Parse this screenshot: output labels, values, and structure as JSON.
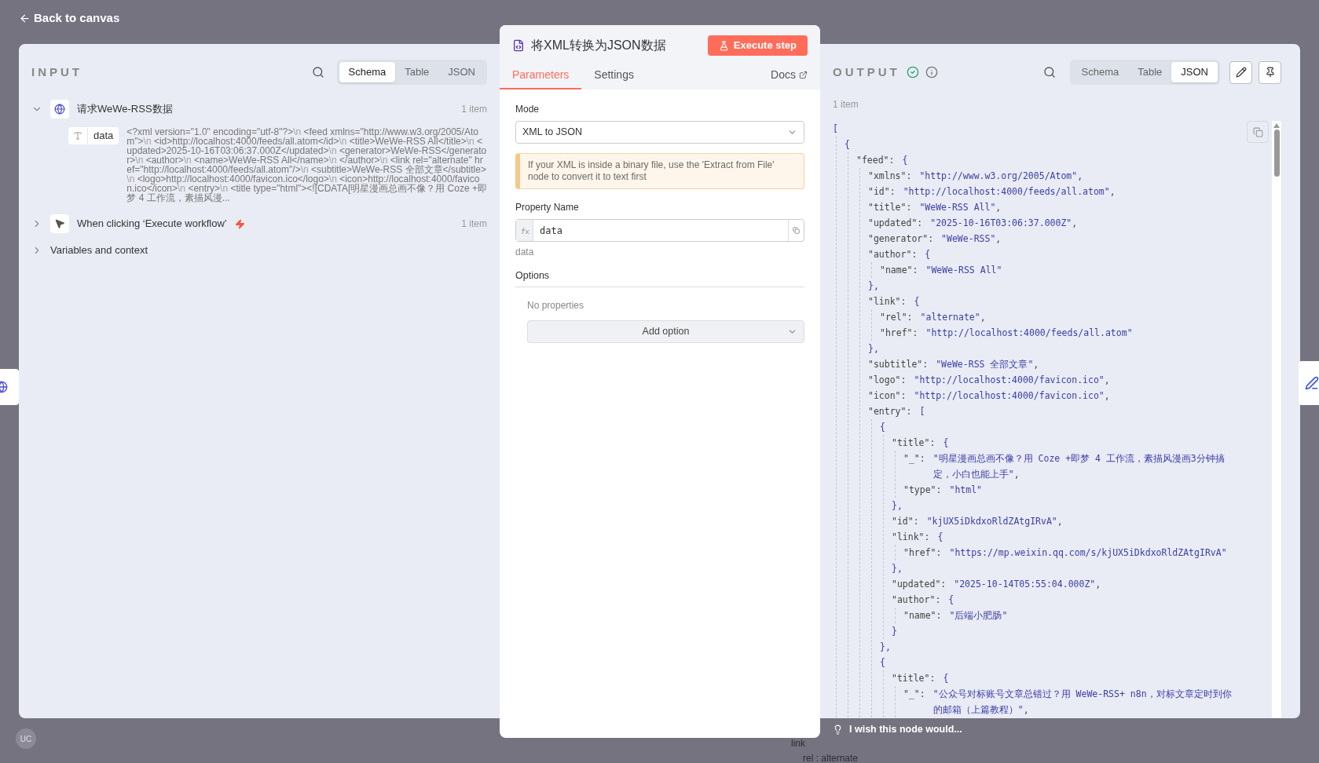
{
  "back_link": "Back to canvas",
  "input": {
    "title": "INPUT",
    "view_tabs": [
      {
        "label": "Schema",
        "selected": true
      },
      {
        "label": "Table",
        "selected": false
      },
      {
        "label": "JSON",
        "selected": false
      }
    ],
    "nodes": [
      {
        "kind": "request",
        "name": "请求WeWe-RSS数据",
        "count": "1 item",
        "expanded": true,
        "fields": [
          {
            "name": "data",
            "value": [
              {
                "kind": "text",
                "text": "<?xml version=\"1.0\" encoding=\"utf-8\"?>"
              },
              {
                "kind": "escape",
                "text": "\\n"
              },
              {
                "kind": "text",
                "text": " <feed xmlns=\"http://www.w3.org/2005/Atom\">"
              },
              {
                "kind": "escape",
                "text": "\\n"
              },
              {
                "kind": "text",
                "text": " <id>http://localhost:4000/feeds/all.atom</id>"
              },
              {
                "kind": "escape",
                "text": "\\n"
              },
              {
                "kind": "text",
                "text": " <title>WeWe-RSS All</title>"
              },
              {
                "kind": "escape",
                "text": "\\n"
              },
              {
                "kind": "text",
                "text": " <updated>2025-10-16T03:06:37.000Z</updated>"
              },
              {
                "kind": "escape",
                "text": "\\n"
              },
              {
                "kind": "text",
                "text": " <generator>WeWe-RSS</generator>"
              },
              {
                "kind": "escape",
                "text": "\\n"
              },
              {
                "kind": "text",
                "text": " <author>"
              },
              {
                "kind": "escape",
                "text": "\\n"
              },
              {
                "kind": "text",
                "text": " <name>WeWe-RSS All</name>"
              },
              {
                "kind": "escape",
                "text": "\\n"
              },
              {
                "kind": "text",
                "text": " </author>"
              },
              {
                "kind": "escape",
                "text": "\\n"
              },
              {
                "kind": "text",
                "text": " <link rel=\"alternate\" href=\"http://localhost:4000/feeds/all.atom\"/>"
              },
              {
                "kind": "escape",
                "text": "\\n"
              },
              {
                "kind": "text",
                "text": " <subtitle>WeWe-RSS 全部文章</subtitle>"
              },
              {
                "kind": "escape",
                "text": "\\n"
              },
              {
                "kind": "text",
                "text": " <logo>http://localhost:4000/favicon.ico</logo>"
              },
              {
                "kind": "escape",
                "text": "\\n"
              },
              {
                "kind": "text",
                "text": " <icon>http://localhost:4000/favicon.ico</icon>"
              },
              {
                "kind": "escape",
                "text": "\\n"
              },
              {
                "kind": "text",
                "text": " <entry>"
              },
              {
                "kind": "escape",
                "text": "\\n"
              },
              {
                "kind": "text",
                "text": " <title type=\"html\"><![CDATA[明星漫画总画不像？用 Coze +即梦 4 工作流，素描风漫..."
              }
            ]
          }
        ]
      },
      {
        "kind": "trigger",
        "name": "When clicking ‘Execute workflow’",
        "count": "1 item",
        "expanded": false
      }
    ],
    "sections": [
      {
        "label": "Variables and context",
        "expanded": false
      }
    ]
  },
  "node_panel": {
    "title": "将XML转换为JSON数据",
    "execute_button": "Execute step",
    "tabs": [
      {
        "label": "Parameters",
        "selected": true
      },
      {
        "label": "Settings",
        "selected": false
      }
    ],
    "docs_link": "Docs",
    "mode": {
      "label": "Mode",
      "value": "XML to JSON"
    },
    "notice": "If your XML is inside a binary file, use the 'Extract from File' node to convert it to text first",
    "property": {
      "label": "Property Name",
      "value": "data",
      "hint": "data"
    },
    "options": {
      "label": "Options",
      "empty_text": "No properties",
      "add_button": "Add option"
    }
  },
  "output": {
    "title": "OUTPUT",
    "success": true,
    "view_tabs": [
      {
        "label": "Schema",
        "selected": false
      },
      {
        "label": "Table",
        "selected": false
      },
      {
        "label": "JSON",
        "selected": true
      }
    ],
    "count": "1 item",
    "json": [
      {
        "value": "[",
        "children": [
          {
            "value": "{",
            "children": [
              {
                "key": "\"feed\":",
                "value": "{",
                "children": [
                  {
                    "key": "\"xmlns\":",
                    "value": "\"http://www.w3.org/2005/Atom\"",
                    "tail": ","
                  },
                  {
                    "key": "\"id\":",
                    "value": "\"http://localhost:4000/feeds/all.atom\"",
                    "tail": ","
                  },
                  {
                    "key": "\"title\":",
                    "value": "\"WeWe-RSS All\"",
                    "tail": ","
                  },
                  {
                    "key": "\"updated\":",
                    "value": "\"2025-10-16T03:06:37.000Z\"",
                    "tail": ","
                  },
                  {
                    "key": "\"generator\":",
                    "value": "\"WeWe-RSS\"",
                    "tail": ","
                  },
                  {
                    "key": "\"author\":",
                    "value": "{",
                    "close": "},",
                    "children": [
                      {
                        "key": "\"name\":",
                        "value": "\"WeWe-RSS All\""
                      }
                    ]
                  },
                  {
                    "key": "\"link\":",
                    "value": "{",
                    "close": "},",
                    "children": [
                      {
                        "key": "\"rel\":",
                        "value": "\"alternate\"",
                        "tail": ","
                      },
                      {
                        "key": "\"href\":",
                        "value": "\"http://localhost:4000/feeds/all.atom\""
                      }
                    ]
                  },
                  {
                    "key": "\"subtitle\":",
                    "value": "\"WeWe-RSS 全部文章\"",
                    "tail": ","
                  },
                  {
                    "key": "\"logo\":",
                    "value": "\"http://localhost:4000/favicon.ico\"",
                    "tail": ","
                  },
                  {
                    "key": "\"icon\":",
                    "value": "\"http://localhost:4000/favicon.ico\"",
                    "tail": ","
                  },
                  {
                    "key": "\"entry\":",
                    "value": "[",
                    "children": [
                      {
                        "value": "{",
                        "close": "},",
                        "children": [
                          {
                            "key": "\"title\":",
                            "value": "{",
                            "close": "},",
                            "children": [
                              {
                                "key": "\"_\":",
                                "value": "\"明星漫画总画不像？用 Coze +即梦 4 工作流，素描风漫画3分钟搞定，小白也能上手\"",
                                "tail": ","
                              },
                              {
                                "key": "\"type\":",
                                "value": "\"html\""
                              }
                            ]
                          },
                          {
                            "key": "\"id\":",
                            "value": "\"kjUX5iDkdxoRldZAtgIRvA\"",
                            "tail": ","
                          },
                          {
                            "key": "\"link\":",
                            "value": "{",
                            "close": "},",
                            "children": [
                              {
                                "key": "\"href\":",
                                "value": "\"https://mp.weixin.qq.com/s/kjUX5iDkdxoRldZAtgIRvA\""
                              }
                            ]
                          },
                          {
                            "key": "\"updated\":",
                            "value": "\"2025-10-14T05:55:04.000Z\"",
                            "tail": ","
                          },
                          {
                            "key": "\"author\":",
                            "value": "{",
                            "close": "}",
                            "children": [
                              {
                                "key": "\"name\":",
                                "value": "\"后端小肥肠\""
                              }
                            ]
                          }
                        ]
                      },
                      {
                        "value": "{",
                        "children": [
                          {
                            "key": "\"title\":",
                            "value": "{",
                            "children": [
                              {
                                "key": "\"_\":",
                                "value": "\"公众号对标账号文章总错过？用 WeWe-RSS+ n8n，对标文章定时到你的邮箱（上篇教程）\"",
                                "tail": ","
                              }
                            ]
                          }
                        ]
                      }
                    ]
                  }
                ]
              }
            ]
          }
        ]
      }
    ]
  },
  "feedback": "I wish this node would...",
  "avatar": "UC",
  "background_texts": [
    "link",
    "rel : alternate"
  ]
}
